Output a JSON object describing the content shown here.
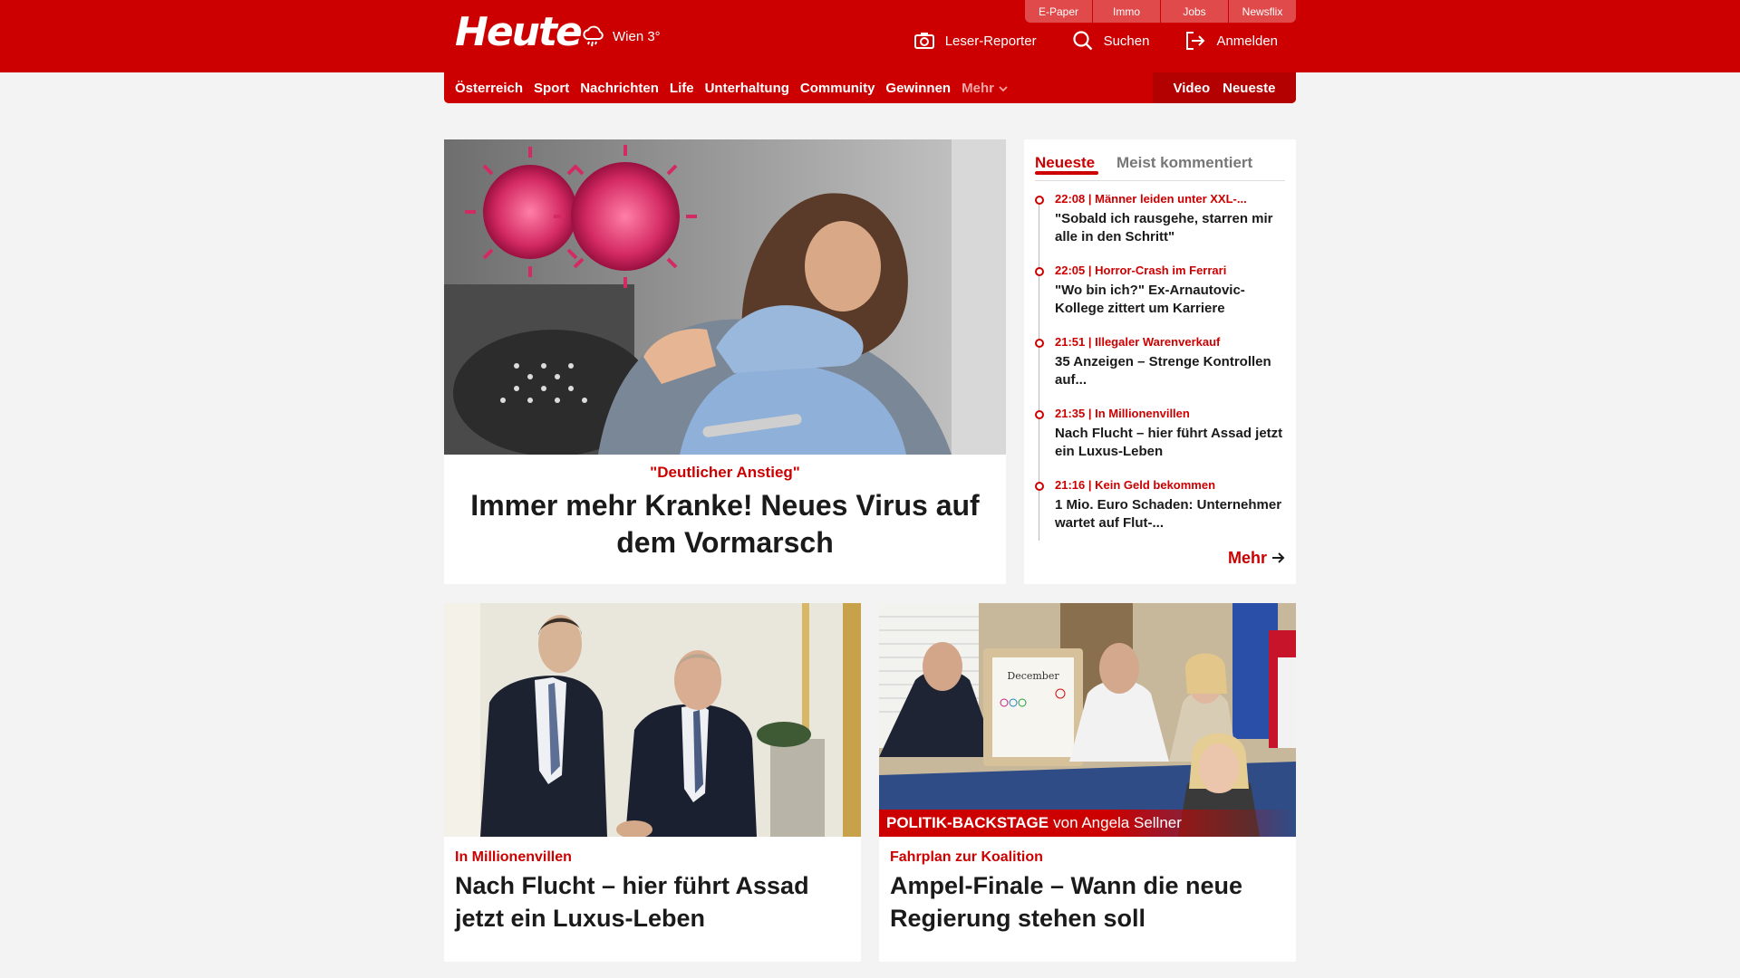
{
  "brand": {
    "logo": "Heute",
    "weather_city": "Wien 3°",
    "weather_icon": "rain-cloud-icon",
    "accent_color": "#cc0000"
  },
  "service_tabs": [
    "E-Paper",
    "Immo",
    "Jobs",
    "Newsflix"
  ],
  "header_actions": {
    "reporter": "Leser-Reporter",
    "search": "Suchen",
    "login": "Anmelden"
  },
  "nav": {
    "items": [
      "Österreich",
      "Sport",
      "Nachrichten",
      "Life",
      "Unterhaltung",
      "Community",
      "Gewinnen"
    ],
    "more": "Mehr",
    "video": "Video",
    "latest": "Neueste"
  },
  "hero": {
    "kicker": "\"Deutlicher Anstieg\"",
    "title": "Immer mehr Kranke! Neues Virus auf dem Vormarsch"
  },
  "sidebar": {
    "tab_active": "Neueste",
    "tab_inactive": "Meist kommentiert",
    "items": [
      {
        "meta": "22:08 | Männer leiden unter XXL-...",
        "headline": "\"Sobald ich rausgehe, starren mir alle in den Schritt\""
      },
      {
        "meta": "22:05 | Horror-Crash im Ferrari",
        "headline": "\"Wo bin ich?\" Ex-Arnautovic-Kollege zittert um Karriere"
      },
      {
        "meta": "21:51 | Illegaler Warenverkauf",
        "headline": "35 Anzeigen – Strenge Kontrollen auf..."
      },
      {
        "meta": "21:35 | In Millionenvillen",
        "headline": "Nach Flucht – hier führt Assad jetzt ein Luxus-Leben"
      },
      {
        "meta": "21:16 | Kein Geld bekommen",
        "headline": "1 Mio. Euro Schaden: Unternehmer wartet auf Flut-..."
      }
    ],
    "more": "Mehr"
  },
  "articles": [
    {
      "kicker": "In Millionenvillen",
      "title": "Nach Flucht – hier führt Assad jetzt ein Luxus-Leben"
    },
    {
      "kicker": "Fahrplan zur Koalition",
      "title": "Ampel-Finale – Wann die neue Regierung stehen soll",
      "banner_bold": "POLITIK-BACKSTAGE",
      "banner_rest": "von Angela Sellner",
      "calendar_month": "December"
    }
  ]
}
